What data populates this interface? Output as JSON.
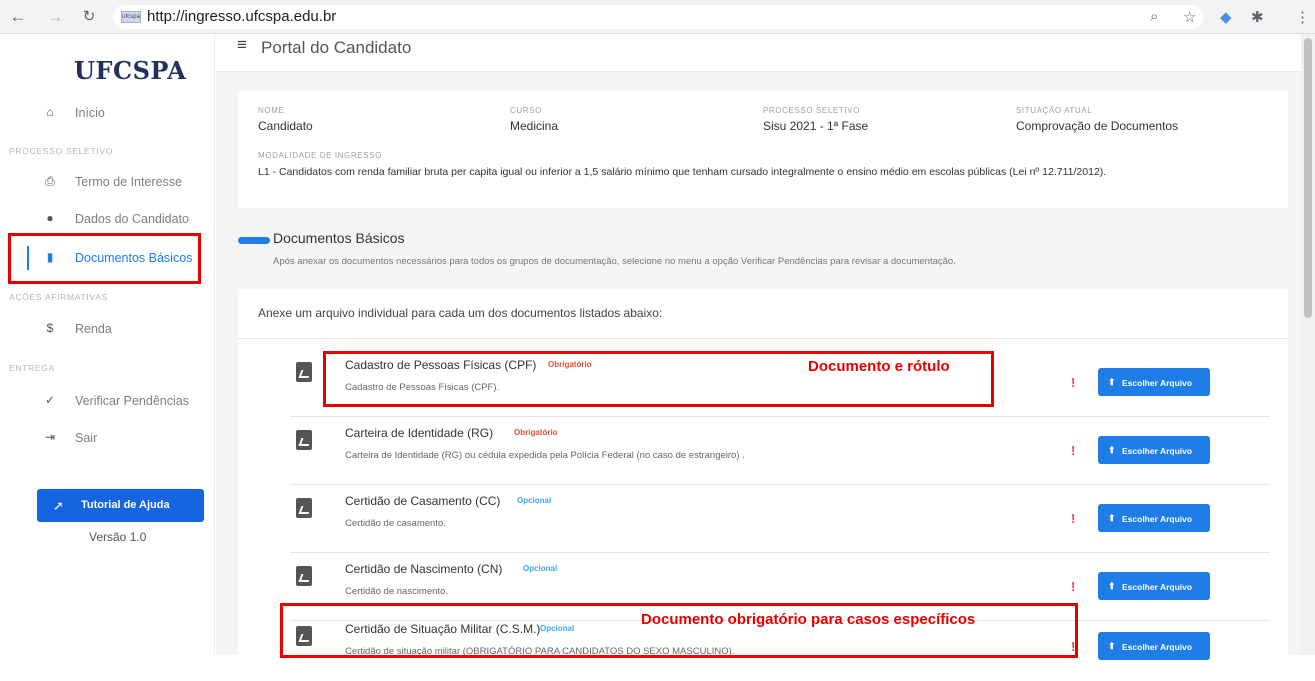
{
  "browser": {
    "url": "http://ingresso.ufcspa.edu.br",
    "favicon_text": "ufcspa"
  },
  "sidebar": {
    "logo": "UFCSPA",
    "home": "Início",
    "section_processo": "PROCESSO SELETIVO",
    "termo": "Termo de Interesse",
    "dados": "Dados do Candidato",
    "documentos": "Documentos Básicos",
    "section_acoes": "AÇÕES AFIRMATIVAS",
    "renda": "Renda",
    "section_entrega": "ENTREGA",
    "verificar": "Verificar Pendências",
    "sair": "Sair",
    "tutorial": "Tutorial de Ajuda",
    "version": "Versão 1.0"
  },
  "header": {
    "title": "Portal do Candidato"
  },
  "info": {
    "nome_label": "NOME",
    "nome": "Candidato",
    "curso_label": "CURSO",
    "curso": "Medicina",
    "processo_label": "PROCESSO SELETIVO",
    "processo": "Sisu 2021 - 1ª Fase",
    "situacao_label": "SITUAÇÃO ATUAL",
    "situacao": "Comprovação de Documentos",
    "modalidade_label": "MODALIDADE DE INGRESSO",
    "modalidade": "L1 - Candidatos com renda familiar bruta per capita igual ou inferior a 1,5 salário mínimo que tenham cursado integralmente o ensino médio em escolas públicas (Lei nº 12.711/2012)."
  },
  "docs_section": {
    "title": "Documentos Básicos",
    "description": "Após anexar os documentos necessários para todos os grupos de documentação, selecione no menu a opção Verificar Pendências para revisar a documentação.",
    "instruction": "Anexe um arquivo individual para cada um dos documentos listados abaixo:",
    "choose_label": "Escolher Arquivo",
    "documents": [
      {
        "name": "Cadastro de Pessoas Físicas (CPF)",
        "tag": "Obrigatório",
        "description": "Cadastro de Pessoas Físicas (CPF)."
      },
      {
        "name": "Carteira de Identidade (RG)",
        "tag": "Obrigatório",
        "description": "Carteira de Identidade (RG) ou cédula expedida pela Polícia Federal (no caso de estrangeiro) ."
      },
      {
        "name": "Certidão de Casamento (CC)",
        "tag": "Opcional",
        "description": "Certidão de casamento."
      },
      {
        "name": "Certidão de Nascimento (CN)",
        "tag": "Opcional",
        "description": "Certidão de nascimento."
      },
      {
        "name": "Certidão de Situação Militar (C.S.M.)",
        "tag": "Opcional",
        "description": "Certidão de situação militar (OBRIGATÓRIO PARA CANDIDATOS DO SEXO MASCULINO)."
      }
    ]
  },
  "annotations": {
    "label1": "Documento e rótulo",
    "label2": "Documento obrigatório para casos específicos"
  },
  "colors": {
    "accent": "#1e7de6",
    "required": "#e74c3c",
    "optional": "#3fa9e6",
    "annotation": "#e60000"
  }
}
